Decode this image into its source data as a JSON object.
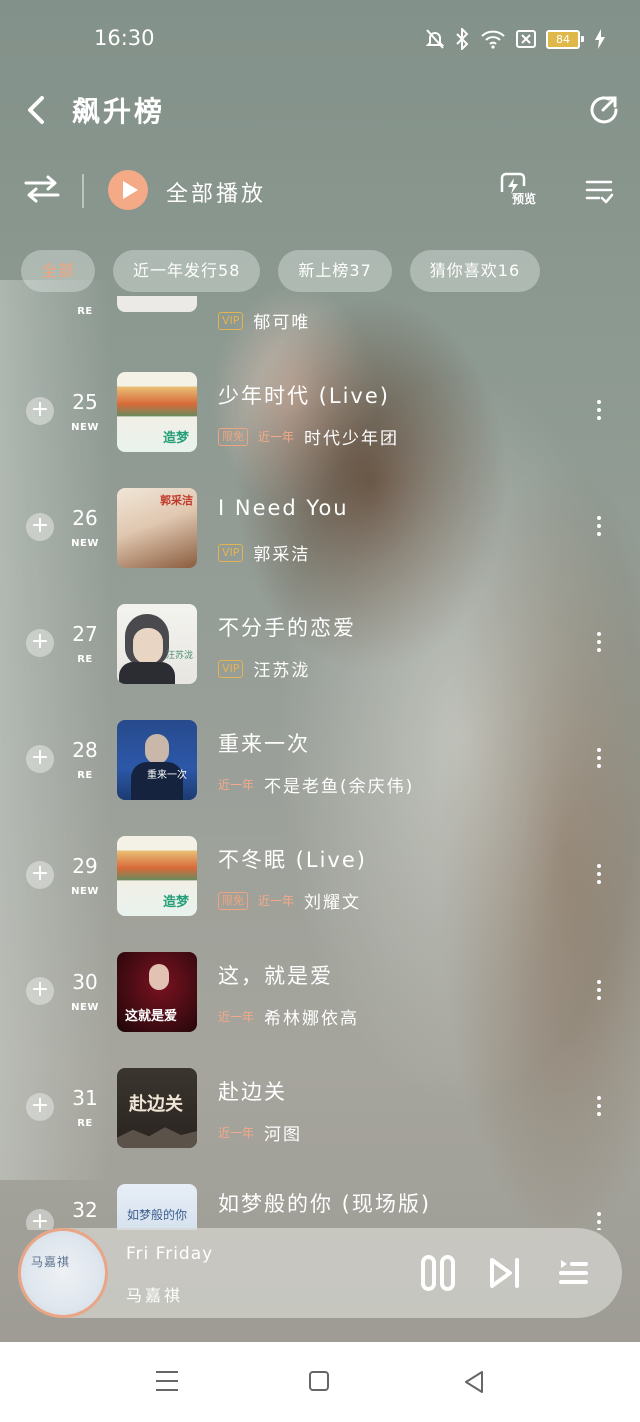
{
  "status_bar": {
    "time": "16:30",
    "battery": "84"
  },
  "header": {
    "title": "飙升榜"
  },
  "toolbar": {
    "play_all_label": "全部播放",
    "preview_label": "预览"
  },
  "filters": [
    {
      "label": "全部",
      "active": true
    },
    {
      "label": "近一年发行58",
      "active": false
    },
    {
      "label": "新上榜37",
      "active": false
    },
    {
      "label": "猜你喜欢16",
      "active": false
    }
  ],
  "partial_row": {
    "tag": "RE",
    "badge": "VIP",
    "artist": "郁可唯"
  },
  "songs": [
    {
      "rank": "25",
      "tag": "NEW",
      "title": "少年时代 (Live)",
      "badges": [
        "限免"
      ],
      "recent": "近一年",
      "artist": "时代少年团",
      "cover": "group-photo",
      "cover_text": "造梦"
    },
    {
      "rank": "26",
      "tag": "NEW",
      "title": "I Need You",
      "badges": [
        "VIP"
      ],
      "recent": "",
      "artist": "郭采洁",
      "cover": "girl-portrait",
      "cover_text": "郭采洁"
    },
    {
      "rank": "27",
      "tag": "RE",
      "title": "不分手的恋爱",
      "badges": [
        "VIP"
      ],
      "recent": "",
      "artist": "汪苏泷",
      "cover": "boy-portrait",
      "cover_text": "汪苏泷"
    },
    {
      "rank": "28",
      "tag": "RE",
      "title": "重来一次",
      "badges": [],
      "recent": "近一年",
      "artist": "不是老鱼(余庆伟)",
      "cover": "blue-portrait",
      "cover_text": "重来一次"
    },
    {
      "rank": "29",
      "tag": "NEW",
      "title": "不冬眠 (Live)",
      "badges": [
        "限免"
      ],
      "recent": "近一年",
      "artist": "刘耀文",
      "cover": "group-photo",
      "cover_text": "造梦"
    },
    {
      "rank": "30",
      "tag": "NEW",
      "title": "这，就是爱",
      "badges": [],
      "recent": "近一年",
      "artist": "希林娜依高",
      "cover": "red-portrait",
      "cover_text": "这就是爱"
    },
    {
      "rank": "31",
      "tag": "RE",
      "title": "赴边关",
      "badges": [],
      "recent": "近一年",
      "artist": "河图",
      "cover": "dark-landscape",
      "cover_text": "赴边关"
    },
    {
      "rank": "32",
      "tag": "",
      "title": "如梦般的你 (现场版)",
      "badges": [],
      "recent": "",
      "artist": "",
      "cover": "light-blue",
      "cover_text": "如梦般的你"
    }
  ],
  "now_playing": {
    "title": "Fri Friday",
    "artist": "马嘉祺",
    "cover_text": "马嘉祺"
  },
  "icons": [
    "back-icon",
    "share-icon",
    "shuffle-icon",
    "play-icon",
    "preview-icon",
    "list-select-icon",
    "add-icon",
    "more-icon",
    "pause-icon",
    "next-icon",
    "playlist-icon"
  ],
  "colors": {
    "accent": "#f4a987",
    "vip": "#e3b452",
    "recent": "#f5a98a"
  }
}
